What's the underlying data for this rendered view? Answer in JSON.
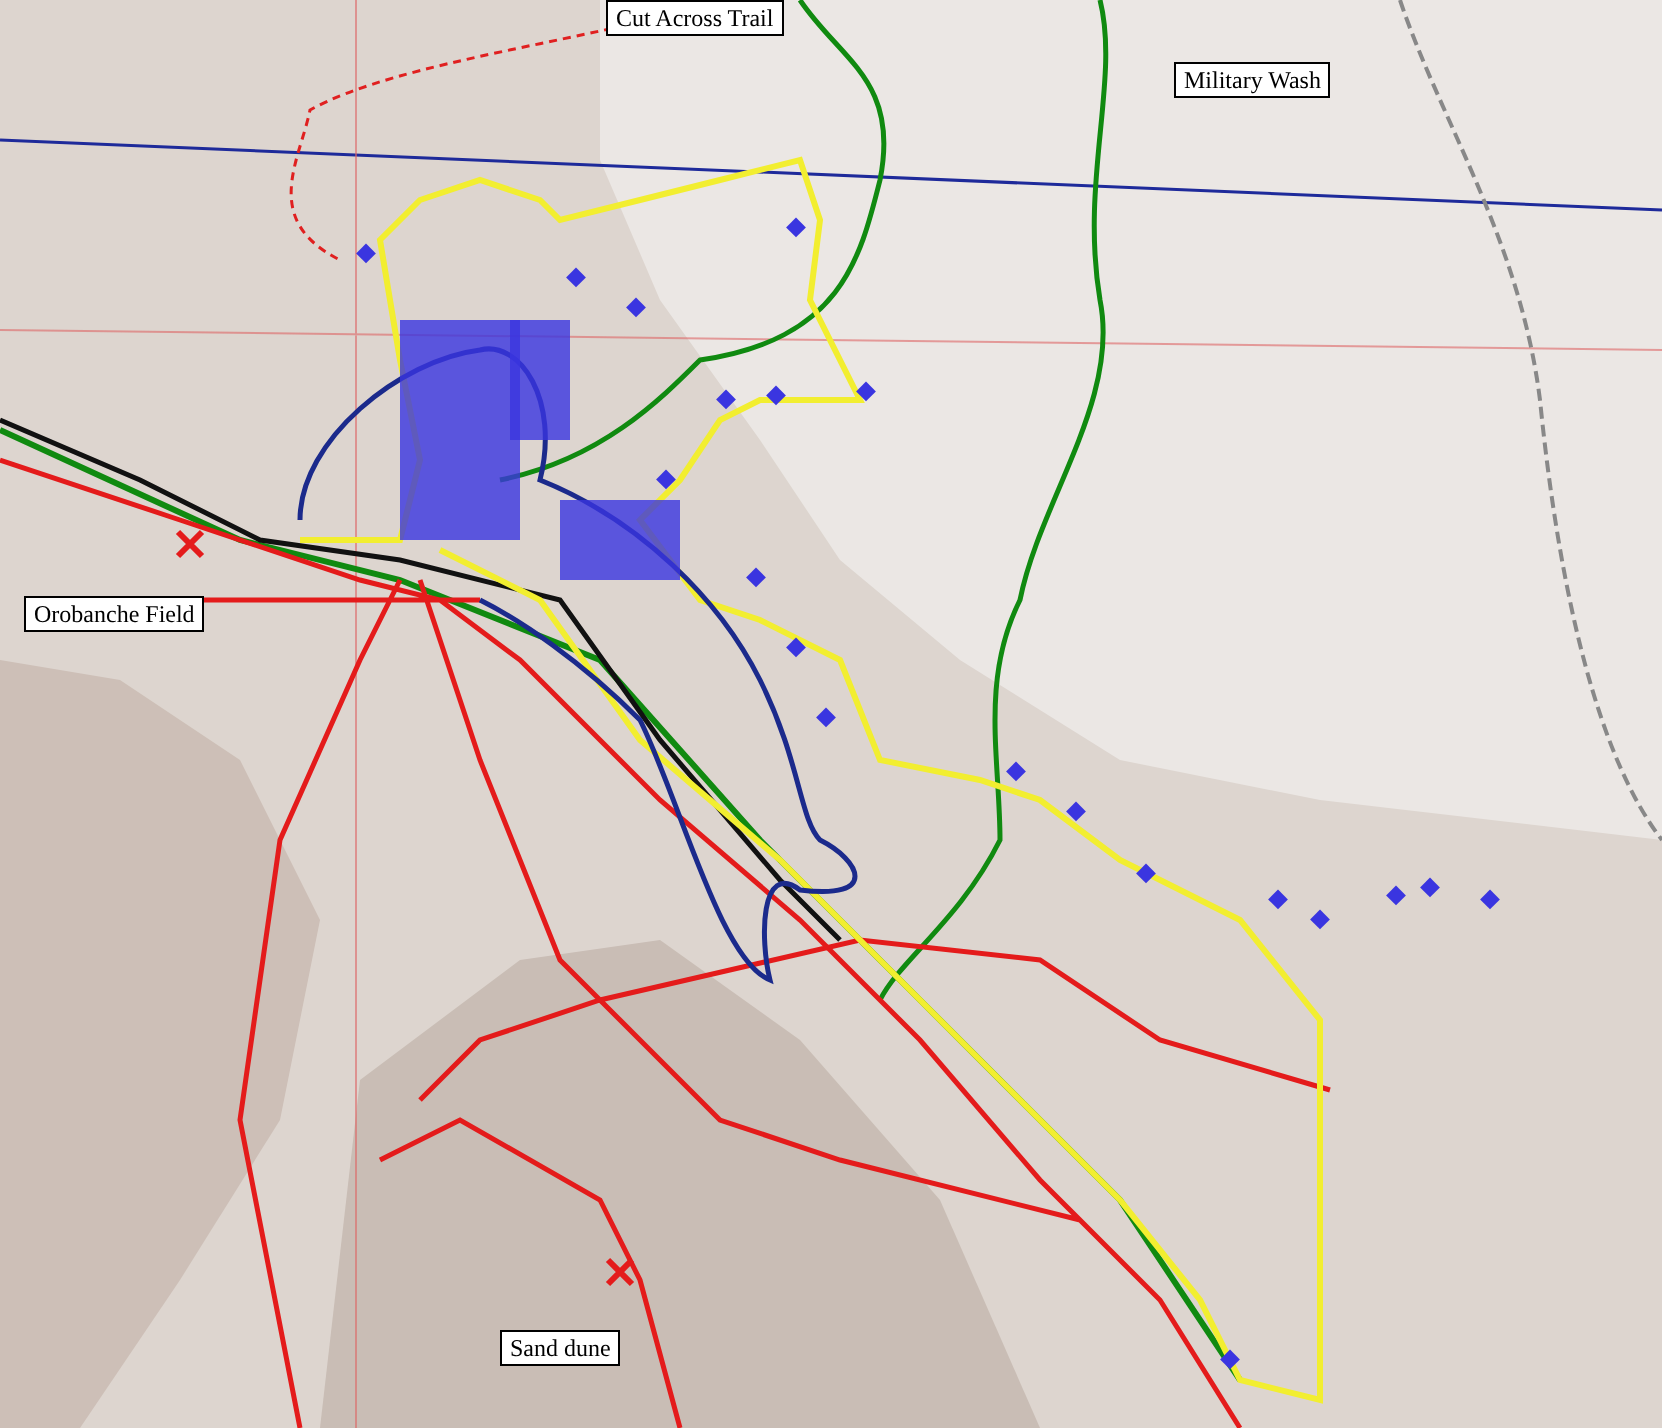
{
  "map": {
    "labels": [
      {
        "text": "Cut Across Trail"
      },
      {
        "text": "Military Wash"
      },
      {
        "text": "Orobanche Field"
      },
      {
        "text": "Sand dune"
      }
    ]
  }
}
